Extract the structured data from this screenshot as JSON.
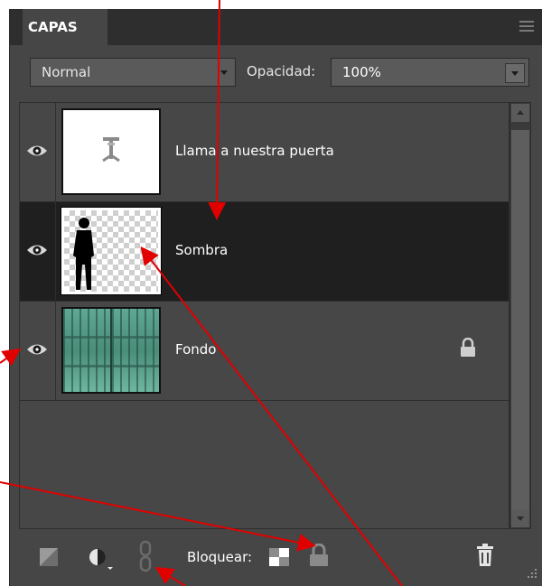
{
  "panel": {
    "tab_label": "CAPAS",
    "menu_icon": "panel-menu-icon"
  },
  "toolbar": {
    "blend_mode": "Normal",
    "opacity_label": "Opacidad:",
    "opacity_value": "100%"
  },
  "layers": [
    {
      "name": "Llama a nuestra puerta",
      "visible": true,
      "selected": false,
      "locked": false,
      "thumbnail": "text-layer"
    },
    {
      "name": "Sombra",
      "visible": true,
      "selected": true,
      "locked": false,
      "thumbnail": "silhouette-on-transparency"
    },
    {
      "name": "Fondo",
      "visible": true,
      "selected": false,
      "locked": true,
      "thumbnail": "green-wooden-door"
    }
  ],
  "bottom_bar": {
    "lock_label": "Bloquear:",
    "icons": [
      "new-layer-icon",
      "adjustment-layer-icon",
      "link-layers-icon",
      "lock-transparency-icon",
      "lock-all-icon",
      "delete-layer-icon"
    ]
  },
  "colors": {
    "panel_bg": "#464646",
    "selected_row": "#1f1f1f",
    "annotation_arrow": "#e00000"
  }
}
